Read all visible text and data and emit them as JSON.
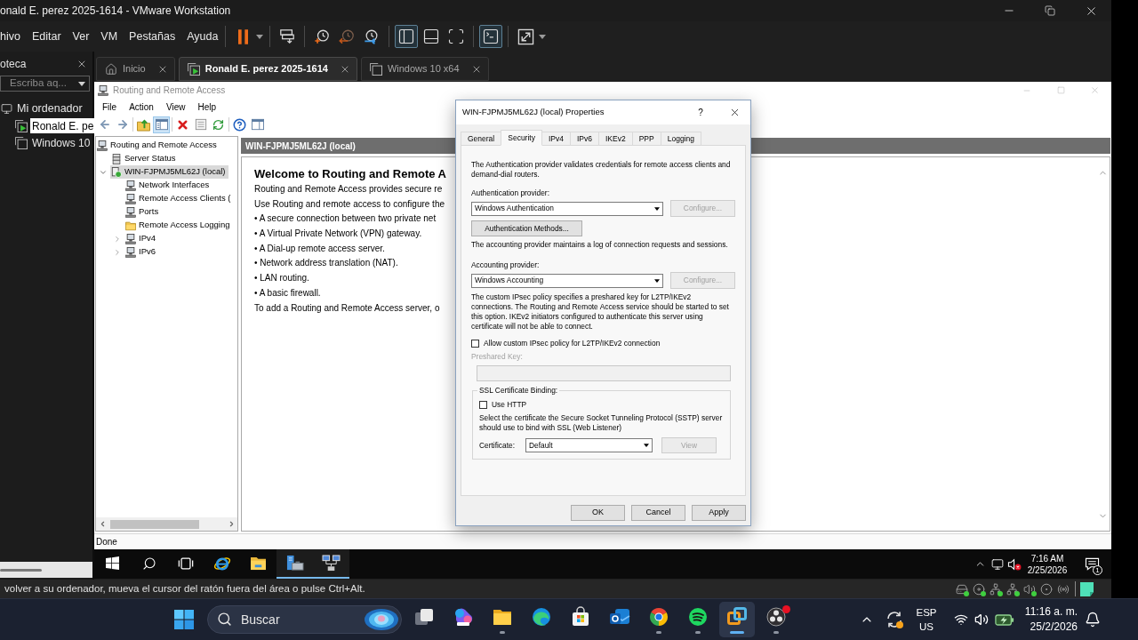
{
  "window": {
    "title": "onald E. perez 2025-1614 - VMware Workstation"
  },
  "menu": [
    "hivo",
    "Editar",
    "Ver",
    "VM",
    "Pestañas",
    "Ayuda"
  ],
  "toolbar": [
    [
      {
        "kind": "pause",
        "dropdown": true
      }
    ],
    [
      {
        "kind": "send-keys"
      }
    ],
    [
      {
        "kind": "snapshot"
      },
      {
        "kind": "revert"
      },
      {
        "kind": "snapshot-manager"
      }
    ],
    [
      {
        "kind": "library",
        "selected": true
      },
      {
        "kind": "thumbnails",
        "selected": false
      },
      {
        "kind": "fit",
        "selected": false
      }
    ],
    [
      {
        "kind": "console",
        "selected": true
      }
    ],
    [
      {
        "kind": "fullscreen",
        "dropdown": true
      }
    ]
  ],
  "library": {
    "title": "oteca",
    "search": {
      "placeholder": "Escriba aq..."
    },
    "tree": [
      {
        "label": "Mi ordenador",
        "kind": "computer",
        "selected": false,
        "children": [
          {
            "label": "Ronald E. pe",
            "kind": "vm",
            "running": true,
            "selected": true
          },
          {
            "label": "Windows 10",
            "kind": "vm",
            "running": false,
            "selected": false
          }
        ]
      }
    ]
  },
  "tabs": [
    {
      "label": "Inicio",
      "kind": "home",
      "selected": false
    },
    {
      "label": "Ronald E. perez 2025-1614",
      "kind": "vm",
      "running": true,
      "selected": true
    },
    {
      "label": "Windows 10 x64",
      "kind": "vm",
      "running": false,
      "selected": false
    }
  ],
  "guest": {
    "mmc": {
      "title": "Routing and Remote Access",
      "menu": [
        "File",
        "Action",
        "View",
        "Help"
      ],
      "toolbar": [
        [
          {
            "kind": "back",
            "selected": false
          },
          {
            "kind": "forward",
            "selected": false
          }
        ],
        [
          {
            "kind": "up",
            "selected": false
          },
          {
            "kind": "tree",
            "selected": true
          }
        ],
        [
          {
            "kind": "delete",
            "selected": false
          },
          {
            "kind": "properties",
            "selected": false
          },
          {
            "kind": "refresh",
            "selected": false
          }
        ],
        [
          {
            "kind": "help",
            "selected": false
          },
          {
            "kind": "panel",
            "selected": false
          }
        ]
      ],
      "tree": [
        {
          "label": "Routing and Remote Access",
          "kind": "root",
          "selected": false,
          "children": [
            {
              "label": "Server Status",
              "kind": "status",
              "selected": false
            },
            {
              "label": "WIN-FJPMJ5ML62J (local)",
              "kind": "server",
              "expanded": true,
              "selected": true,
              "children": [
                {
                  "label": "Network Interfaces",
                  "kind": "node",
                  "selected": false
                },
                {
                  "label": "Remote Access Clients (",
                  "kind": "node",
                  "selected": false
                },
                {
                  "label": "Ports",
                  "kind": "node",
                  "selected": false
                },
                {
                  "label": "Remote Access Logging",
                  "kind": "folder",
                  "selected": false
                },
                {
                  "label": "IPv4",
                  "kind": "node",
                  "expanded": false,
                  "selected": false
                },
                {
                  "label": "IPv6",
                  "kind": "node",
                  "expanded": false,
                  "selected": false
                }
              ]
            }
          ]
        }
      ],
      "pane_header": "WIN-FJPMJ5ML62J (local)",
      "welcome": {
        "heading": "Welcome to Routing and Remote A",
        "paragraphs": [
          "Routing and Remote Access provides secure re",
          "Use Routing and remote access to configure the"
        ],
        "bullets": [
          "• A secure connection between two private net",
          "• A Virtual Private Network (VPN) gateway.",
          "• A Dial-up remote access server.",
          "• Network address translation (NAT).",
          "• LAN routing.",
          "• A basic firewall."
        ],
        "footer": "To add a Routing and Remote Access server, o"
      },
      "status": "Done"
    },
    "taskbar": {
      "apps": [
        {
          "kind": "start",
          "running": false
        },
        {
          "kind": "search",
          "running": false
        },
        {
          "kind": "task-view",
          "running": false
        },
        {
          "kind": "ie",
          "running": false
        },
        {
          "kind": "explorer",
          "running": false
        },
        {
          "kind": "server-manager",
          "running": true
        },
        {
          "kind": "rras",
          "running": true
        }
      ],
      "muted": true,
      "time": "7:16 AM",
      "date": "2/25/2026",
      "notifications": "1"
    }
  },
  "dialog": {
    "title": "WIN-FJPMJ5ML62J (local) Properties",
    "help": "?",
    "tabs": [
      {
        "label": "General",
        "selected": false
      },
      {
        "label": "Security",
        "selected": true
      },
      {
        "label": "IPv4",
        "selected": false
      },
      {
        "label": "IPv6",
        "selected": false
      },
      {
        "label": "IKEv2",
        "selected": false
      },
      {
        "label": "PPP",
        "selected": false
      },
      {
        "label": "Logging",
        "selected": false
      }
    ],
    "auth_text": "The Authentication provider validates credentials for remote access clients and demand-dial routers.",
    "auth_provider": {
      "label": "Authentication provider:",
      "value": "Windows Authentication",
      "button": {
        "label": "Configure...",
        "disabled": true
      }
    },
    "auth_methods_button": {
      "label": "Authentication Methods...",
      "disabled": false
    },
    "accounting_text": "The accounting provider maintains a log of connection requests and sessions.",
    "accounting_provider": {
      "label": "Accounting provider:",
      "value": "Windows Accounting",
      "button": {
        "label": "Configure...",
        "disabled": true
      }
    },
    "ipsec_text": "The custom IPsec policy specifies a preshared key for L2TP/IKEv2 connections. The Routing and Remote Access service should be started to set this option. IKEv2 initiators configured to authenticate this server using certificate will not be able to connect.",
    "ipsec_checkbox": {
      "label": "Allow custom IPsec policy for L2TP/IKEv2 connection",
      "checked": false
    },
    "preshared_key": {
      "label": "Preshared Key:",
      "disabled": true
    },
    "ssl_group": {
      "title": "SSL Certificate Binding:",
      "use_http": {
        "label": "Use HTTP",
        "checked": false
      },
      "text": "Select the certificate the Secure Socket Tunneling Protocol (SSTP) server should use to bind with SSL (Web Listener)",
      "certificate": {
        "label": "Certificate:",
        "value": "Default"
      },
      "view_button": {
        "label": "View",
        "disabled": true
      }
    },
    "buttons": [
      {
        "label": "OK",
        "disabled": false
      },
      {
        "label": "Cancel",
        "disabled": false
      },
      {
        "label": "Apply",
        "disabled": false
      }
    ]
  },
  "vm_status": {
    "message": "volver a su ordenador, mueva el cursor del ratón fuera del área o pulse Ctrl+Alt.",
    "devices": [
      {
        "kind": "disk",
        "active": true
      },
      {
        "kind": "cd",
        "active": true
      },
      {
        "kind": "network",
        "active": true
      },
      {
        "kind": "network",
        "active": true
      },
      {
        "kind": "sound",
        "active": true
      },
      {
        "kind": "camera",
        "active": false
      },
      {
        "kind": "wireless",
        "active": false
      }
    ]
  },
  "host_taskbar": {
    "search": {
      "placeholder": "Buscar"
    },
    "apps": [
      {
        "kind": "task-view",
        "running": false,
        "selected": false,
        "badge": false
      },
      {
        "kind": "m365",
        "running": false,
        "selected": false,
        "badge": false
      },
      {
        "kind": "explorer",
        "running": true,
        "selected": false,
        "badge": false
      },
      {
        "kind": "edge",
        "running": false,
        "selected": false,
        "badge": false
      },
      {
        "kind": "store",
        "running": false,
        "selected": false,
        "badge": false
      },
      {
        "kind": "outlook",
        "running": false,
        "selected": false,
        "badge": false
      },
      {
        "kind": "chrome",
        "running": true,
        "selected": false,
        "badge": false
      },
      {
        "kind": "spotify",
        "running": true,
        "selected": false,
        "badge": false
      },
      {
        "kind": "vmware",
        "running": true,
        "selected": true,
        "badge": false
      },
      {
        "kind": "obs",
        "running": true,
        "selected": false,
        "badge": true
      }
    ],
    "language": {
      "code": "ESP",
      "layout": "US"
    },
    "time": "11:16 a. m.",
    "date": "25/2/2026"
  }
}
